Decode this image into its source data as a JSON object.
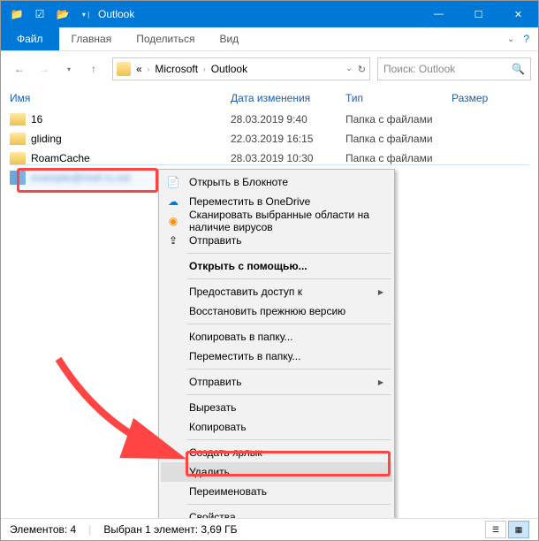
{
  "window": {
    "title": "Outlook"
  },
  "ribbon": {
    "file": "Файл",
    "home": "Главная",
    "share": "Поделиться",
    "view": "Вид"
  },
  "breadcrumbs": {
    "b1": "Microsoft",
    "b2": "Outlook"
  },
  "search": {
    "placeholder": "Поиск: Outlook"
  },
  "headers": {
    "name": "Имя",
    "date": "Дата изменения",
    "type": "Тип",
    "size": "Размер"
  },
  "rows": [
    {
      "name": "16",
      "date": "28.03.2019 9:40",
      "type": "Папка с файлами"
    },
    {
      "name": "gliding",
      "date": "22.03.2019 16:15",
      "type": "Папка с файлами"
    },
    {
      "name": "RoamCache",
      "date": "28.03.2019 10:30",
      "type": "Папка с файлами"
    }
  ],
  "selected_item": "example@mail.ru.ost",
  "context": {
    "open_notepad": "Открыть в Блокноте",
    "onedrive": "Переместить в OneDrive",
    "scan": "Сканировать выбранные области на наличие вирусов",
    "send": "Отправить",
    "open_with": "Открыть с помощью...",
    "grant_access": "Предоставить доступ к",
    "restore": "Восстановить прежнюю версию",
    "copy_to": "Копировать в папку...",
    "move_to": "Переместить в папку...",
    "send2": "Отправить",
    "cut": "Вырезать",
    "copy": "Копировать",
    "shortcut": "Создать ярлык",
    "delete": "Удалить",
    "rename": "Переименовать",
    "props": "Свойства"
  },
  "status": {
    "elements": "Элементов: 4",
    "selected": "Выбран 1 элемент: 3,69 ГБ"
  }
}
